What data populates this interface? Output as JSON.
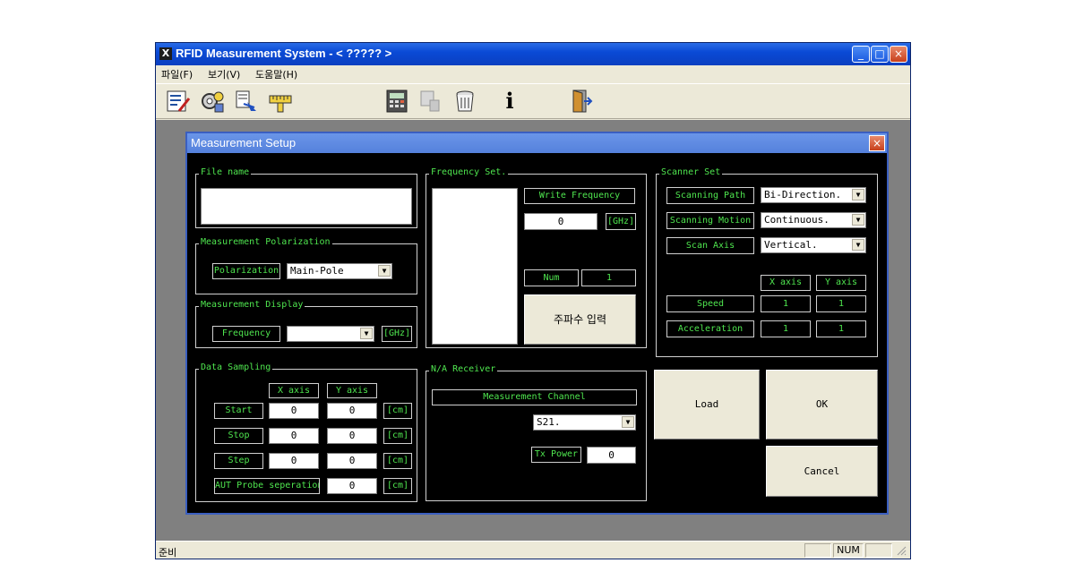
{
  "window": {
    "title": "RFID Measurement System - < ????? >",
    "app_icon": "X",
    "minimize": "_",
    "maximize": "□",
    "close": "×"
  },
  "menu": [
    "파일(F)",
    "보기(V)",
    "도움말(H)"
  ],
  "toolbar": {
    "icons": [
      "edit-form-icon",
      "gear-settings-icon",
      "motion-scan-icon",
      "ruler-icon",
      "calculator-icon",
      "hand-point-icon",
      "trash-icon",
      "info-icon",
      "exit-door-icon"
    ],
    "info_glyph": "i"
  },
  "status": {
    "ready": "준비",
    "num": "NUM"
  },
  "dialog": {
    "title": "Measurement Setup",
    "close": "×",
    "file_name": {
      "group": "File name",
      "value": ""
    },
    "polarization": {
      "group": "Measurement Polarization",
      "label": "Polarization",
      "value": "Main-Pole"
    },
    "display": {
      "group": "Measurement Display",
      "label": "Frequency",
      "value": "",
      "unit": "[GHz]"
    },
    "data_sampling": {
      "group": "Data Sampling",
      "x_axis": "X axis",
      "y_axis": "Y axis",
      "rows": [
        {
          "label": "Start",
          "x": "0",
          "y": "0",
          "unit": "[cm]"
        },
        {
          "label": "Stop",
          "x": "0",
          "y": "0",
          "unit": "[cm]"
        },
        {
          "label": "Step",
          "x": "0",
          "y": "0",
          "unit": "[cm]"
        }
      ],
      "aut": {
        "label": "AUT Probe seperation",
        "value": "0",
        "unit": "[cm]"
      }
    },
    "frequency_set": {
      "group": "Frequency Set.",
      "write_label": "Write Frequency",
      "write_value": "0",
      "unit": "[GHz]",
      "num_label": "Num",
      "num_value": "1",
      "input_button": "주파수 입력"
    },
    "na_receiver": {
      "group": "N/A Receiver",
      "channel_label": "Measurement Channel",
      "channel_value": "S21.",
      "tx_label": "Tx Power",
      "tx_value": "0"
    },
    "scanner_set": {
      "group": "Scanner Set",
      "path_label": "Scanning Path",
      "path_value": "Bi-Direction.",
      "motion_label": "Scanning Motion",
      "motion_value": "Continuous.",
      "axis_label": "Scan Axis",
      "axis_value": "Vertical.",
      "x_axis": "X axis",
      "y_axis": "Y axis",
      "speed_label": "Speed",
      "speed_x": "1",
      "speed_y": "1",
      "accel_label": "Acceleration",
      "accel_x": "1",
      "accel_y": "1"
    },
    "buttons": {
      "load": "Load",
      "ok": "OK",
      "cancel": "Cancel"
    }
  }
}
